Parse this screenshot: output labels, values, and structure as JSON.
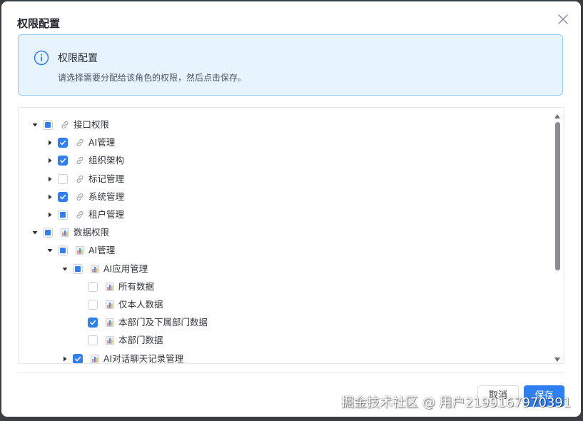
{
  "dialog": {
    "title": "权限配置",
    "alert": {
      "title": "权限配置",
      "description": "请选择需要分配给该角色的权限，然后点击保存。"
    },
    "tree": [
      {
        "label": "接口权限",
        "state": "partial",
        "expander": "expanded",
        "icon": "link-icon",
        "level": 0
      },
      {
        "label": "AI管理",
        "state": "checked",
        "expander": "collapsed",
        "icon": "link-icon",
        "level": 1
      },
      {
        "label": "组织架构",
        "state": "checked",
        "expander": "collapsed",
        "icon": "link-icon",
        "level": 1
      },
      {
        "label": "标记管理",
        "state": "unchecked",
        "expander": "collapsed",
        "icon": "link-icon",
        "level": 1
      },
      {
        "label": "系统管理",
        "state": "checked",
        "expander": "collapsed",
        "icon": "link-icon",
        "level": 1
      },
      {
        "label": "租户管理",
        "state": "partial",
        "expander": "collapsed",
        "icon": "link-icon",
        "level": 1
      },
      {
        "label": "数据权限",
        "state": "partial",
        "expander": "expanded",
        "icon": "chart-icon",
        "level": 0
      },
      {
        "label": "AI管理",
        "state": "partial",
        "expander": "expanded",
        "icon": "chart-icon",
        "level": 1
      },
      {
        "label": "AI应用管理",
        "state": "partial",
        "expander": "expanded",
        "icon": "chart-icon",
        "level": 2
      },
      {
        "label": "所有数据",
        "state": "unchecked",
        "expander": "none",
        "icon": "chart-icon",
        "level": 3
      },
      {
        "label": "仅本人数据",
        "state": "unchecked",
        "expander": "none",
        "icon": "chart-icon",
        "level": 3
      },
      {
        "label": "本部门及下属部门数据",
        "state": "checked",
        "expander": "none",
        "icon": "chart-icon",
        "level": 3
      },
      {
        "label": "本部门数据",
        "state": "unchecked",
        "expander": "none",
        "icon": "chart-icon",
        "level": 3
      },
      {
        "label": "AI对话聊天记录管理",
        "state": "checked",
        "expander": "collapsed",
        "icon": "chart-icon",
        "level": 2
      }
    ],
    "buttons": {
      "cancel": "取消",
      "save": "保存"
    }
  },
  "watermark": "掘金技术社区 @ 用户2199167970391",
  "colors": {
    "primary": "#2f7ff0",
    "alert_bg": "#e8f4fd",
    "alert_border": "#91cbf1"
  }
}
